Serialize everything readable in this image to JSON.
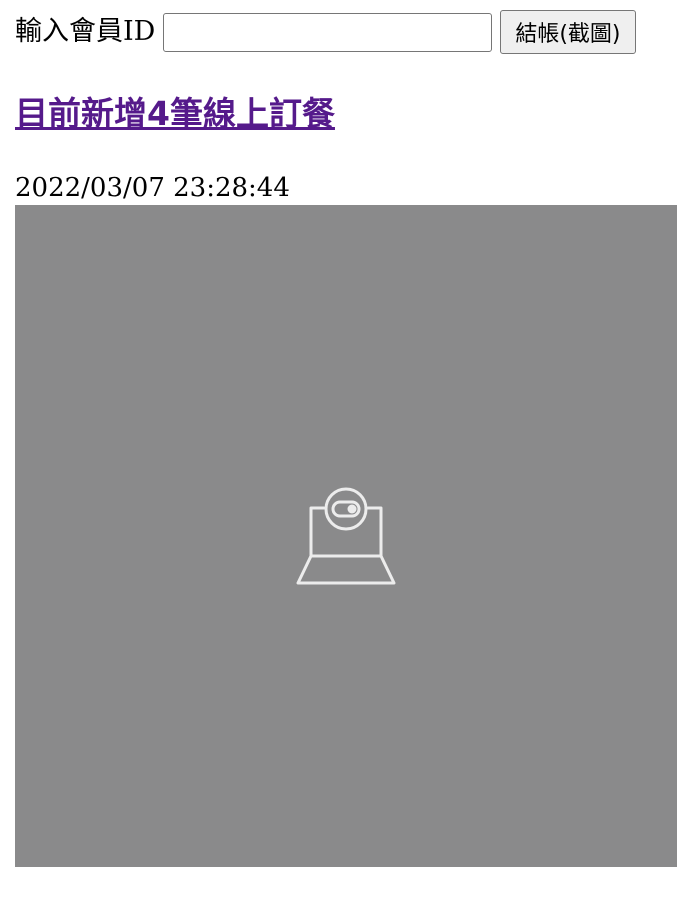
{
  "member": {
    "label": "輸入會員ID",
    "input_value": "",
    "checkout_button_label": "結帳(截圖)"
  },
  "orders": {
    "link_text": "目前新增4筆線上訂餐"
  },
  "status": {
    "timestamp": "2022/03/07 23:28:44"
  },
  "camera": {
    "background_color": "#8a8a8b",
    "icon": "webcam-off-icon"
  },
  "colors": {
    "visited_link": "#551a8b"
  }
}
